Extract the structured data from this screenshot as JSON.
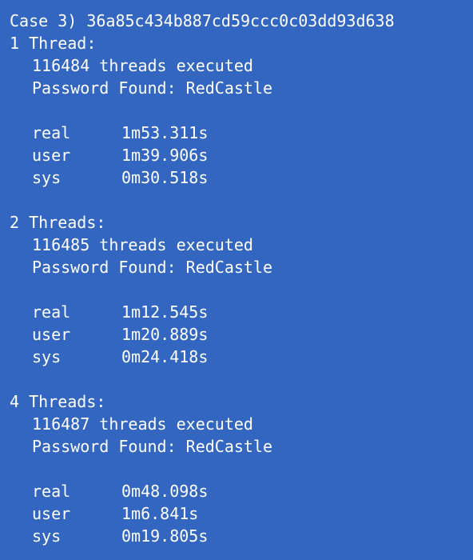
{
  "header": "Case 3) 36a85c434b887cd59ccc0c03dd93d638",
  "runs": [
    {
      "title": "1 Thread:",
      "executed": "116484 threads executed",
      "found": "Password Found: RedCastle",
      "times": [
        {
          "label": "real",
          "value": "1m53.311s"
        },
        {
          "label": "user",
          "value": "1m39.906s"
        },
        {
          "label": "sys",
          "value": "0m30.518s"
        }
      ]
    },
    {
      "title": "2 Threads:",
      "executed": "116485 threads executed",
      "found": "Password Found: RedCastle",
      "times": [
        {
          "label": "real",
          "value": "1m12.545s"
        },
        {
          "label": "user",
          "value": "1m20.889s"
        },
        {
          "label": "sys",
          "value": "0m24.418s"
        }
      ]
    },
    {
      "title": "4 Threads:",
      "executed": "116487 threads executed",
      "found": "Password Found: RedCastle",
      "times": [
        {
          "label": "real",
          "value": "0m48.098s"
        },
        {
          "label": "user",
          "value": "1m6.841s"
        },
        {
          "label": "sys",
          "value": "0m19.805s"
        }
      ]
    }
  ],
  "colors": {
    "background": "#3366c0",
    "text": "#ffffff"
  }
}
